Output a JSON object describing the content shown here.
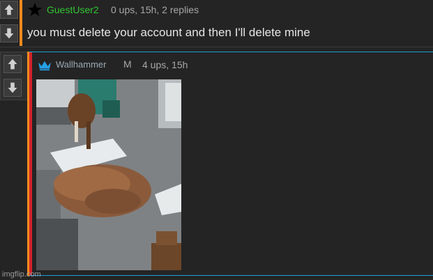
{
  "comment1": {
    "username": "GuestUser2",
    "meta": "0 ups, 15h, 2 replies",
    "text": "you must delete your account and then I'll delete mine"
  },
  "comment2": {
    "username": "Wallhammer",
    "badge": "M",
    "meta": "4 ups, 15h"
  },
  "watermark": "imgflip.com",
  "icons": {
    "upvote": "arrow-up-icon",
    "downvote": "arrow-down-icon",
    "star": "star-icon",
    "crown": "crown-icon"
  },
  "colors": {
    "background": "#242424",
    "orange_bar": "#f08a1e",
    "red_bar": "#d2232a",
    "blue_rule": "#1d9fd8",
    "username_green": "#31c431"
  }
}
